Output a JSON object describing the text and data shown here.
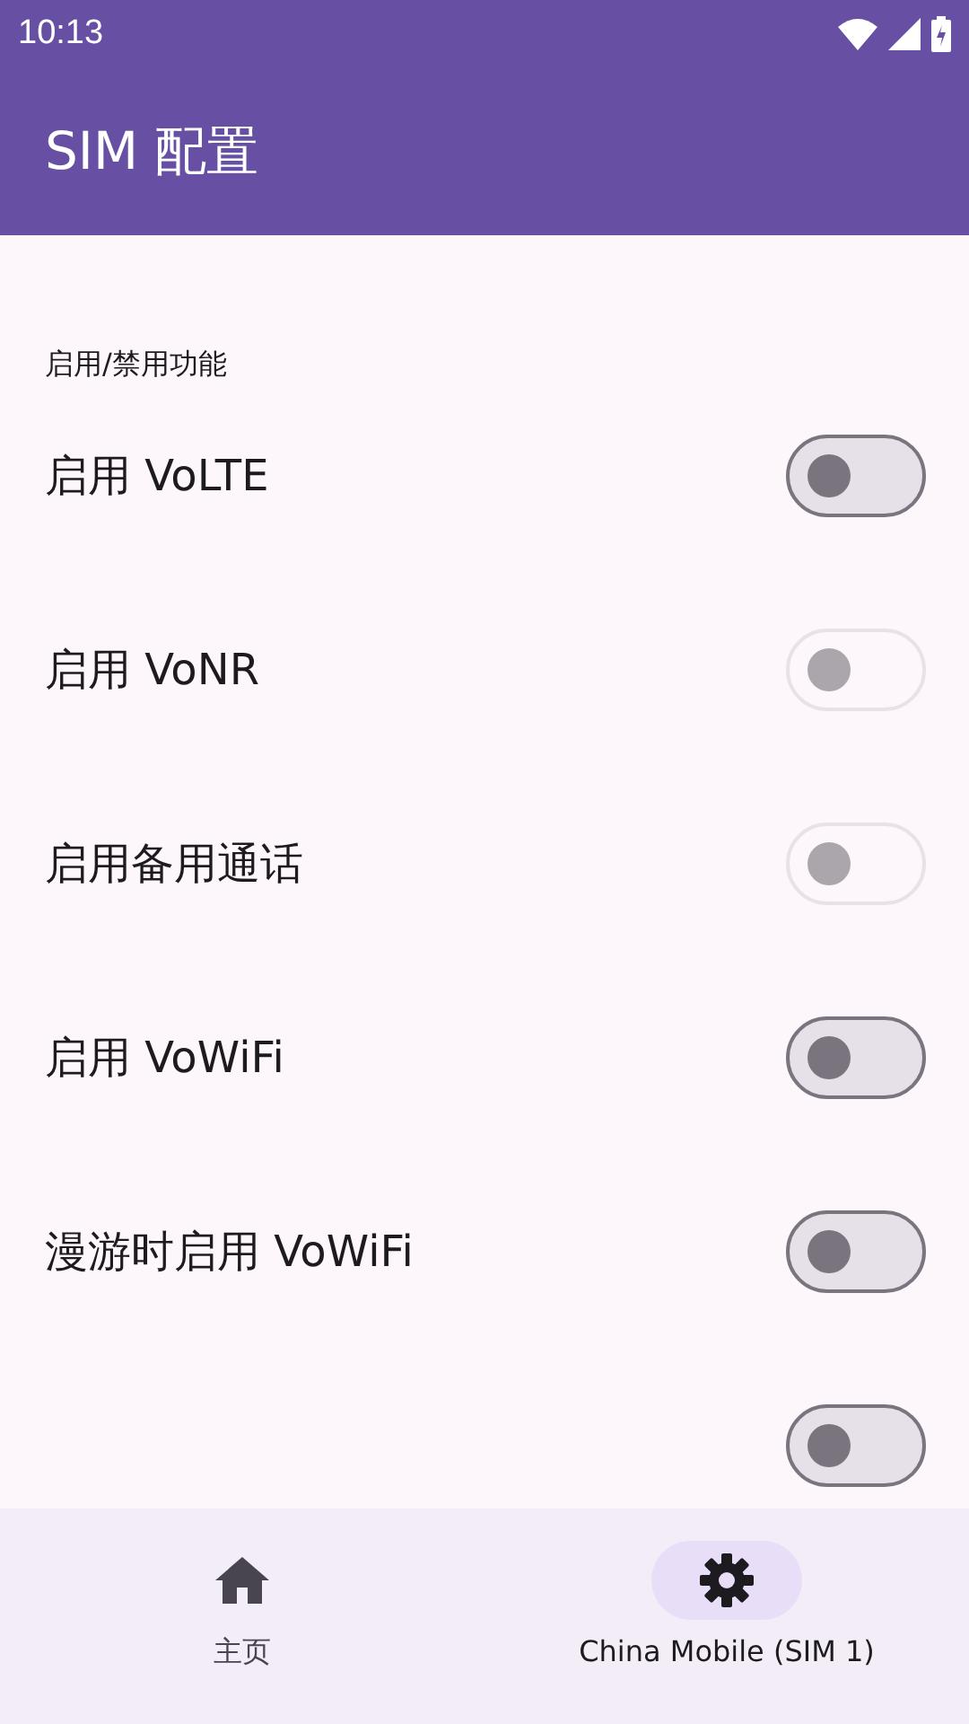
{
  "status_bar": {
    "time": "10:13"
  },
  "app_bar": {
    "title": "SIM 配置"
  },
  "section": {
    "title": "启用/禁用功能"
  },
  "settings": [
    {
      "label": "启用 VoLTE",
      "checked": false,
      "disabled": false
    },
    {
      "label": "启用 VoNR",
      "checked": false,
      "disabled": true
    },
    {
      "label": "启用备用通话",
      "checked": false,
      "disabled": true
    },
    {
      "label": "启用 VoWiFi",
      "checked": false,
      "disabled": false
    },
    {
      "label": "漫游时启用 VoWiFi",
      "checked": false,
      "disabled": false
    },
    {
      "checked": false,
      "disabled": false
    }
  ],
  "nav": [
    {
      "kind": "home",
      "label": "主页",
      "selected": false
    },
    {
      "kind": "settings",
      "label": "China Mobile (SIM 1)",
      "selected": true
    }
  ]
}
